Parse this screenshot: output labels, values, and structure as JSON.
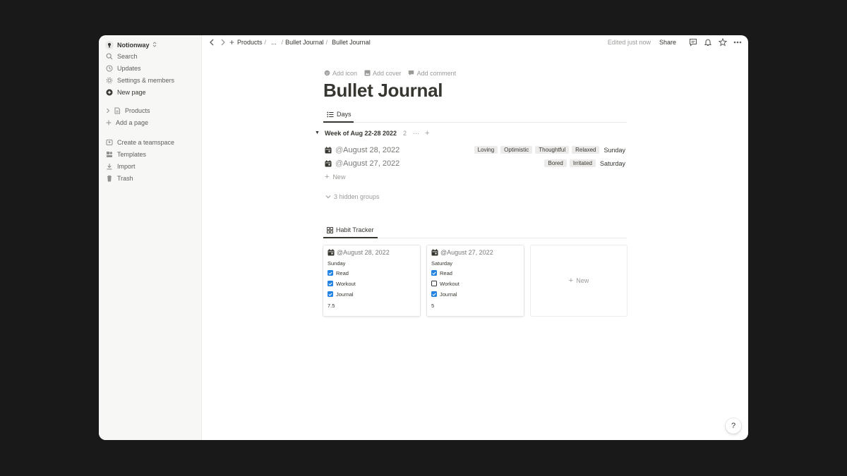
{
  "sidebar": {
    "workspace": "Notionway",
    "items": [
      {
        "label": "Search",
        "icon": "search-icon"
      },
      {
        "label": "Updates",
        "icon": "clock-icon"
      },
      {
        "label": "Settings & members",
        "icon": "gear-icon"
      },
      {
        "label": "New page",
        "icon": "plus-circle-icon"
      }
    ],
    "pages": [
      {
        "label": "Products",
        "icon": "page-icon"
      }
    ],
    "add_page": "Add a page",
    "bottom": [
      {
        "label": "Create a teamspace",
        "icon": "teamspace-icon"
      },
      {
        "label": "Templates",
        "icon": "templates-icon"
      },
      {
        "label": "Import",
        "icon": "import-icon"
      },
      {
        "label": "Trash",
        "icon": "trash-icon"
      }
    ]
  },
  "topbar": {
    "breadcrumbs": [
      "Products",
      "...",
      "Bullet Journal",
      "Bullet Journal"
    ],
    "edited": "Edited just now",
    "share": "Share"
  },
  "page": {
    "actions": [
      "Add icon",
      "Add cover",
      "Add comment"
    ],
    "title": "Bullet Journal"
  },
  "days_view": {
    "tab": "Days",
    "group_title": "Week of Aug 22-28 2022",
    "group_count": "2",
    "more": "···",
    "rows": [
      {
        "at": "@",
        "date": "August 28, 2022",
        "tags": [
          "Loving",
          "Optimistic",
          "Thoughtful",
          "Relaxed"
        ],
        "day": "Sunday"
      },
      {
        "at": "@",
        "date": "August 27, 2022",
        "tags": [
          "Bored",
          "Irritated"
        ],
        "day": "Saturday"
      }
    ],
    "new_label": "New",
    "hidden_groups": "3 hidden groups"
  },
  "habit_view": {
    "tab": "Habit Tracker",
    "cards": [
      {
        "at": "@",
        "date": "August 28, 2022",
        "day": "Sunday",
        "habits": [
          {
            "label": "Read",
            "checked": true
          },
          {
            "label": "Workout",
            "checked": true
          },
          {
            "label": "Journal",
            "checked": true
          }
        ],
        "score": "7.5"
      },
      {
        "at": "@",
        "date": "August 27, 2022",
        "day": "Saturday",
        "habits": [
          {
            "label": "Read",
            "checked": true
          },
          {
            "label": "Workout",
            "checked": false
          },
          {
            "label": "Journal",
            "checked": true
          }
        ],
        "score": "5"
      }
    ],
    "new_label": "New"
  },
  "help": "?",
  "colors": {
    "accent": "#2383e2",
    "background": "#191919",
    "sidebar": "#f7f7f5",
    "tag": "#ecebe9"
  }
}
